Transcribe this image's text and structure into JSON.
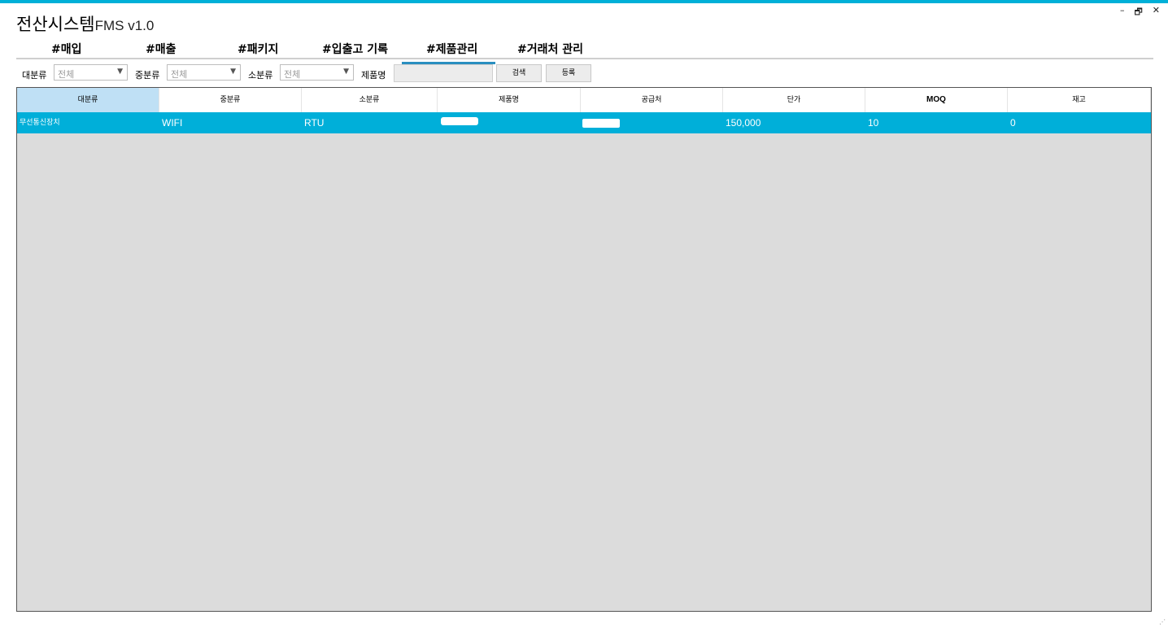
{
  "window": {
    "title": "전산시스템",
    "version": "FMS v1.0",
    "minimize": "–",
    "restore": "🗗",
    "close": "✕"
  },
  "tabs": [
    {
      "label": "#매입",
      "active": false
    },
    {
      "label": "#매출",
      "active": false
    },
    {
      "label": "#패키지",
      "active": false
    },
    {
      "label": "#입출고 기록",
      "active": false
    },
    {
      "label": "#제품관리",
      "active": true
    },
    {
      "label": "#거래처 관리",
      "active": false
    }
  ],
  "filters": {
    "category_large_label": "대분류",
    "category_large_value": "전체",
    "category_mid_label": "중분류",
    "category_mid_value": "전체",
    "category_small_label": "소분류",
    "category_small_value": "전체",
    "product_name_label": "제품명",
    "product_name_value": "",
    "search_button": "검색",
    "register_button": "등록"
  },
  "grid": {
    "columns": [
      "대분류",
      "중분류",
      "소분류",
      "제품명",
      "공급처",
      "단가",
      "MOQ",
      "재고"
    ],
    "rows": [
      [
        "무선통신장치",
        "WIFI",
        "RTU",
        "",
        "",
        "150,000",
        "10",
        "0"
      ]
    ]
  },
  "colors": {
    "accent": "#00b0d8",
    "selected_row": "#00afd9",
    "selected_header": "#bfe0f5",
    "grid_background": "#dcdcdc"
  }
}
